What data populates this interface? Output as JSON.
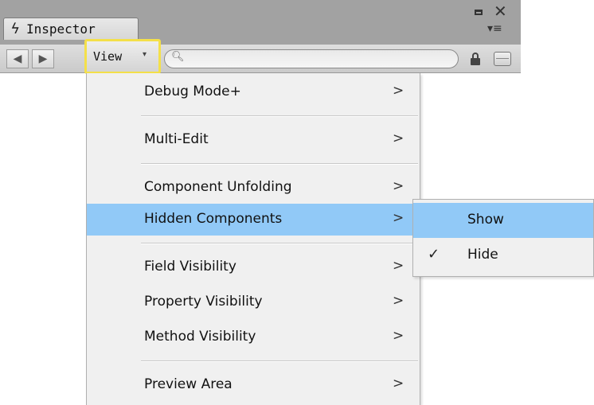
{
  "window": {
    "tab_title": "Inspector",
    "tab_icon": "lightning-bolt-icon",
    "controls": {
      "restore": "▪",
      "close": "✕",
      "menu": "▾≡"
    }
  },
  "toolbar": {
    "back": "◀",
    "forward": "▶",
    "view_label": "View",
    "view_caret": "▾",
    "search_placeholder": "",
    "search_value": ""
  },
  "menu": {
    "items": [
      {
        "label": "Debug Mode+",
        "submenu": ">"
      },
      {
        "label": "Multi-Edit",
        "submenu": ">"
      },
      {
        "label": "Component Unfolding",
        "submenu": ">"
      },
      {
        "label": "Hidden Components",
        "submenu": ">",
        "highlighted": true
      },
      {
        "label": "Field Visibility",
        "submenu": ">"
      },
      {
        "label": "Property Visibility",
        "submenu": ">"
      },
      {
        "label": "Method Visibility",
        "submenu": ">"
      },
      {
        "label": "Preview Area",
        "submenu": ">"
      }
    ]
  },
  "submenu": {
    "items": [
      {
        "label": "Show",
        "checked": false,
        "highlighted": true
      },
      {
        "label": "Hide",
        "checked": true,
        "mark": "✓"
      }
    ]
  },
  "colors": {
    "highlight": "#91c9f7",
    "view_button_outline": "#f4e04a",
    "menu_background": "#f0f0f0"
  }
}
